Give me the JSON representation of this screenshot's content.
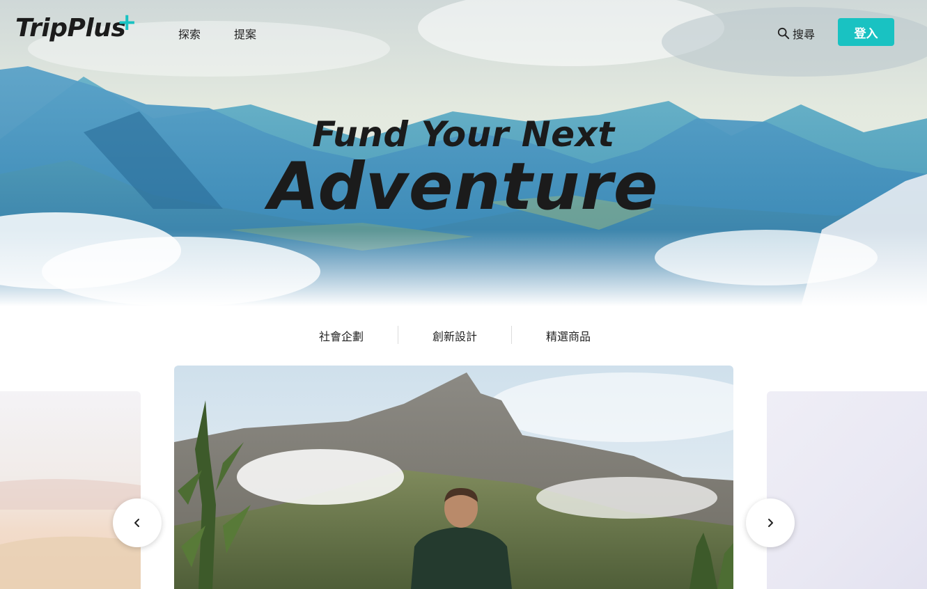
{
  "header": {
    "logo": "TripPlus",
    "logo_mark": "+",
    "nav": [
      {
        "label": "探索"
      },
      {
        "label": "提案"
      }
    ],
    "search": {
      "label": "搜尋",
      "icon": "search-icon"
    },
    "login_label": "登入"
  },
  "hero": {
    "headline_line1": "Fund Your Next",
    "headline_line2": "Adventure"
  },
  "categories": [
    {
      "label": "社會企劃"
    },
    {
      "label": "創新設計"
    },
    {
      "label": "精選商品"
    }
  ],
  "carousel": {
    "prev_icon": "chevron-left-icon",
    "next_icon": "chevron-right-icon"
  },
  "colors": {
    "accent": "#19c2c2",
    "text": "#1b1b1b"
  }
}
